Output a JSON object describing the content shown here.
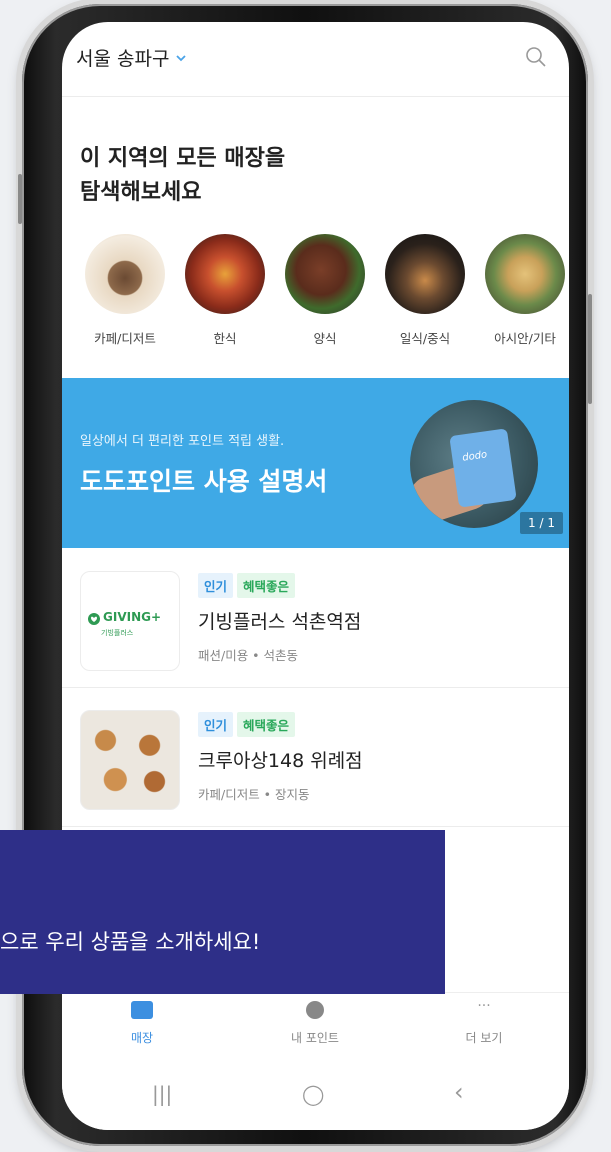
{
  "header": {
    "location": "서울 송파구",
    "search_icon": "search-icon"
  },
  "title_lines": [
    "이 지역의 모든 매장을",
    "탐색해보세요"
  ],
  "categories": [
    {
      "label": "카페/디저트",
      "color": "#d9c3a6"
    },
    {
      "label": "한식",
      "color": "#b2462c"
    },
    {
      "label": "양식",
      "color": "#6a3a26"
    },
    {
      "label": "일식/중식",
      "color": "#3b2e26"
    },
    {
      "label": "아시안/기타",
      "color": "#c9b27a"
    }
  ],
  "banner": {
    "subtitle": "일상에서 더 편리한 포인트 적립 생활.",
    "title": "도도포인트 사용 설명서",
    "card_text": "dodo",
    "page": "1 / 1",
    "color": "#3fa9e6"
  },
  "stores": [
    {
      "badges": [
        "인기",
        "혜택좋은"
      ],
      "name": "기빙플러스 석촌역점",
      "meta": "패션/미용 • 석촌동",
      "logo": {
        "main": "GIVING+",
        "sub": "기빙플러스"
      }
    },
    {
      "badges": [
        "인기",
        "혜택좋은"
      ],
      "name": "크루아상148 위례점",
      "meta": "카페/디저트 • 장지동"
    }
  ],
  "overlay": {
    "text": "으로 우리 상품을 소개하세요!",
    "color": "#2e2f88"
  },
  "nav": [
    {
      "label": "매장",
      "active": true
    },
    {
      "label": "내 포인트",
      "active": false
    },
    {
      "label": "더 보기",
      "active": false
    }
  ],
  "system_nav": {
    "recent": "|||",
    "home": "◯",
    "back": "‹"
  }
}
